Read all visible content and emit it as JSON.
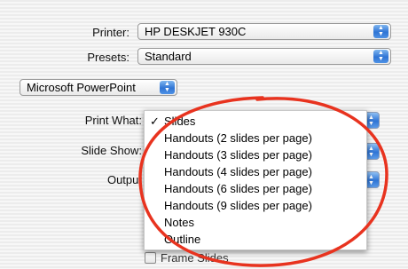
{
  "printer": {
    "label": "Printer:",
    "value": "HP DESKJET 930C"
  },
  "presets": {
    "label": "Presets:",
    "value": "Standard"
  },
  "section": {
    "value": "Microsoft PowerPoint"
  },
  "print_what": {
    "label": "Print What:"
  },
  "slide_show": {
    "label": "Slide Show:"
  },
  "output": {
    "label": "Output"
  },
  "menu": {
    "checked_mark": "✓",
    "items": [
      "Slides",
      "Handouts (2 slides per page)",
      "Handouts (3 slides per page)",
      "Handouts (4 slides per page)",
      "Handouts (6 slides per page)",
      "Handouts (9 slides per page)",
      "Notes",
      "Outline"
    ]
  },
  "frame_slides": {
    "label": "Frame Slides"
  },
  "annotation": {
    "color": "#e8331f"
  }
}
